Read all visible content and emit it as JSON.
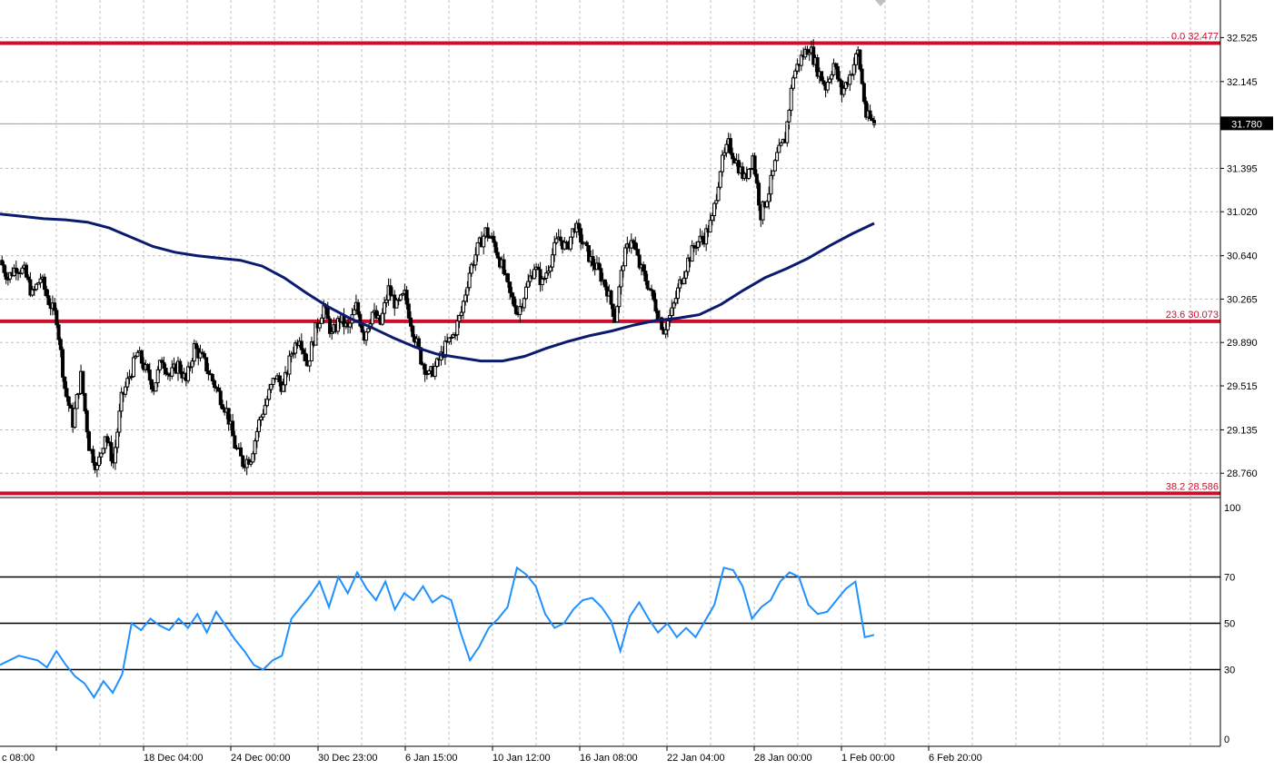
{
  "chart_data": [
    {
      "type": "candlestick",
      "grid": true,
      "ylim": [
        28.55,
        32.85
      ],
      "y_ticks": [
        "32.525",
        "32.145",
        "31.780",
        "31.395",
        "31.020",
        "30.640",
        "30.265",
        "29.890",
        "29.515",
        "29.135",
        "28.760"
      ],
      "current_price": 31.78,
      "current_price_label": "31.780",
      "x_ticks": [
        "c 08:00",
        "18 Dec 04:00",
        "24 Dec 00:00",
        "30 Dec 23:00",
        "6 Jan 15:00",
        "10 Jan 12:00",
        "16 Jan 08:00",
        "22 Jan 04:00",
        "28 Jan 00:00",
        "1 Feb 00:00",
        "6 Feb 20:00"
      ],
      "fibonacci_levels": [
        {
          "label": "0.0 32.477",
          "value": 32.477
        },
        {
          "label": "23.6 30.073",
          "value": 30.073
        },
        {
          "label": "38.2 28.586",
          "value": 28.586
        }
      ],
      "price_path": [
        30.6,
        30.45,
        30.55,
        30.5,
        30.3,
        30.45,
        30.25,
        30.1,
        29.5,
        29.2,
        29.6,
        29.0,
        28.8,
        29.1,
        28.85,
        29.4,
        29.6,
        29.8,
        29.65,
        29.5,
        29.75,
        29.6,
        29.7,
        29.55,
        29.85,
        29.75,
        29.6,
        29.45,
        29.3,
        29.0,
        28.85,
        28.9,
        29.2,
        29.4,
        29.6,
        29.5,
        29.8,
        29.95,
        29.7,
        30.0,
        30.2,
        29.95,
        30.1,
        30.0,
        30.2,
        29.95,
        30.15,
        30.05,
        30.35,
        30.2,
        30.3,
        30.0,
        29.75,
        29.6,
        29.7,
        29.85,
        29.95,
        30.15,
        30.5,
        30.7,
        30.85,
        30.75,
        30.55,
        30.3,
        30.15,
        30.35,
        30.55,
        30.4,
        30.6,
        30.8,
        30.7,
        30.9,
        30.75,
        30.6,
        30.5,
        30.35,
        30.1,
        30.6,
        30.8,
        30.55,
        30.4,
        30.2,
        30.0,
        30.15,
        30.4,
        30.6,
        30.75,
        30.8,
        30.95,
        31.4,
        31.6,
        31.45,
        31.3,
        31.5,
        31.0,
        31.2,
        31.5,
        31.65,
        32.2,
        32.35,
        32.45,
        32.25,
        32.1,
        32.3,
        32.05,
        32.2,
        32.4,
        31.85,
        31.78
      ],
      "indicator_line": [
        31.0,
        30.98,
        30.96,
        30.95,
        30.93,
        30.88,
        30.8,
        30.72,
        30.67,
        30.64,
        30.62,
        30.6,
        30.55,
        30.45,
        30.32,
        30.2,
        30.1,
        30.02,
        29.93,
        29.85,
        29.79,
        29.76,
        29.73,
        29.73,
        29.77,
        29.84,
        29.9,
        29.95,
        29.99,
        30.04,
        30.08,
        30.1,
        30.13,
        30.22,
        30.34,
        30.45,
        30.53,
        30.62,
        30.73,
        30.83,
        30.92
      ]
    },
    {
      "type": "line",
      "ylim": [
        0,
        100
      ],
      "y_ticks": [
        "100",
        "70",
        "50",
        "30",
        "0"
      ],
      "levels": [
        70,
        50,
        30
      ],
      "values": [
        32,
        34,
        36,
        35,
        34,
        31,
        38,
        32,
        27,
        24,
        18,
        25,
        20,
        28,
        50,
        47,
        52,
        49,
        47,
        52,
        48,
        54,
        46,
        55,
        49,
        43,
        38,
        32,
        30,
        34,
        36,
        52,
        57,
        62,
        68,
        57,
        70,
        63,
        72,
        65,
        60,
        68,
        56,
        63,
        60,
        66,
        59,
        62,
        60,
        46,
        34,
        40,
        48,
        52,
        57,
        74,
        71,
        66,
        54,
        48,
        50,
        56,
        60,
        61,
        57,
        51,
        38,
        53,
        59,
        52,
        46,
        50,
        44,
        48,
        44,
        51,
        58,
        74,
        73,
        66,
        52,
        57,
        60,
        68,
        72,
        70,
        58,
        54,
        55,
        60,
        65,
        68,
        44,
        45
      ]
    }
  ],
  "colors": {
    "candle": "#000000",
    "fibonacci": "#c8102e",
    "moving_average": "#0a1a6e",
    "rsi": "#1e90ff",
    "grid": "#c0c0c0"
  }
}
